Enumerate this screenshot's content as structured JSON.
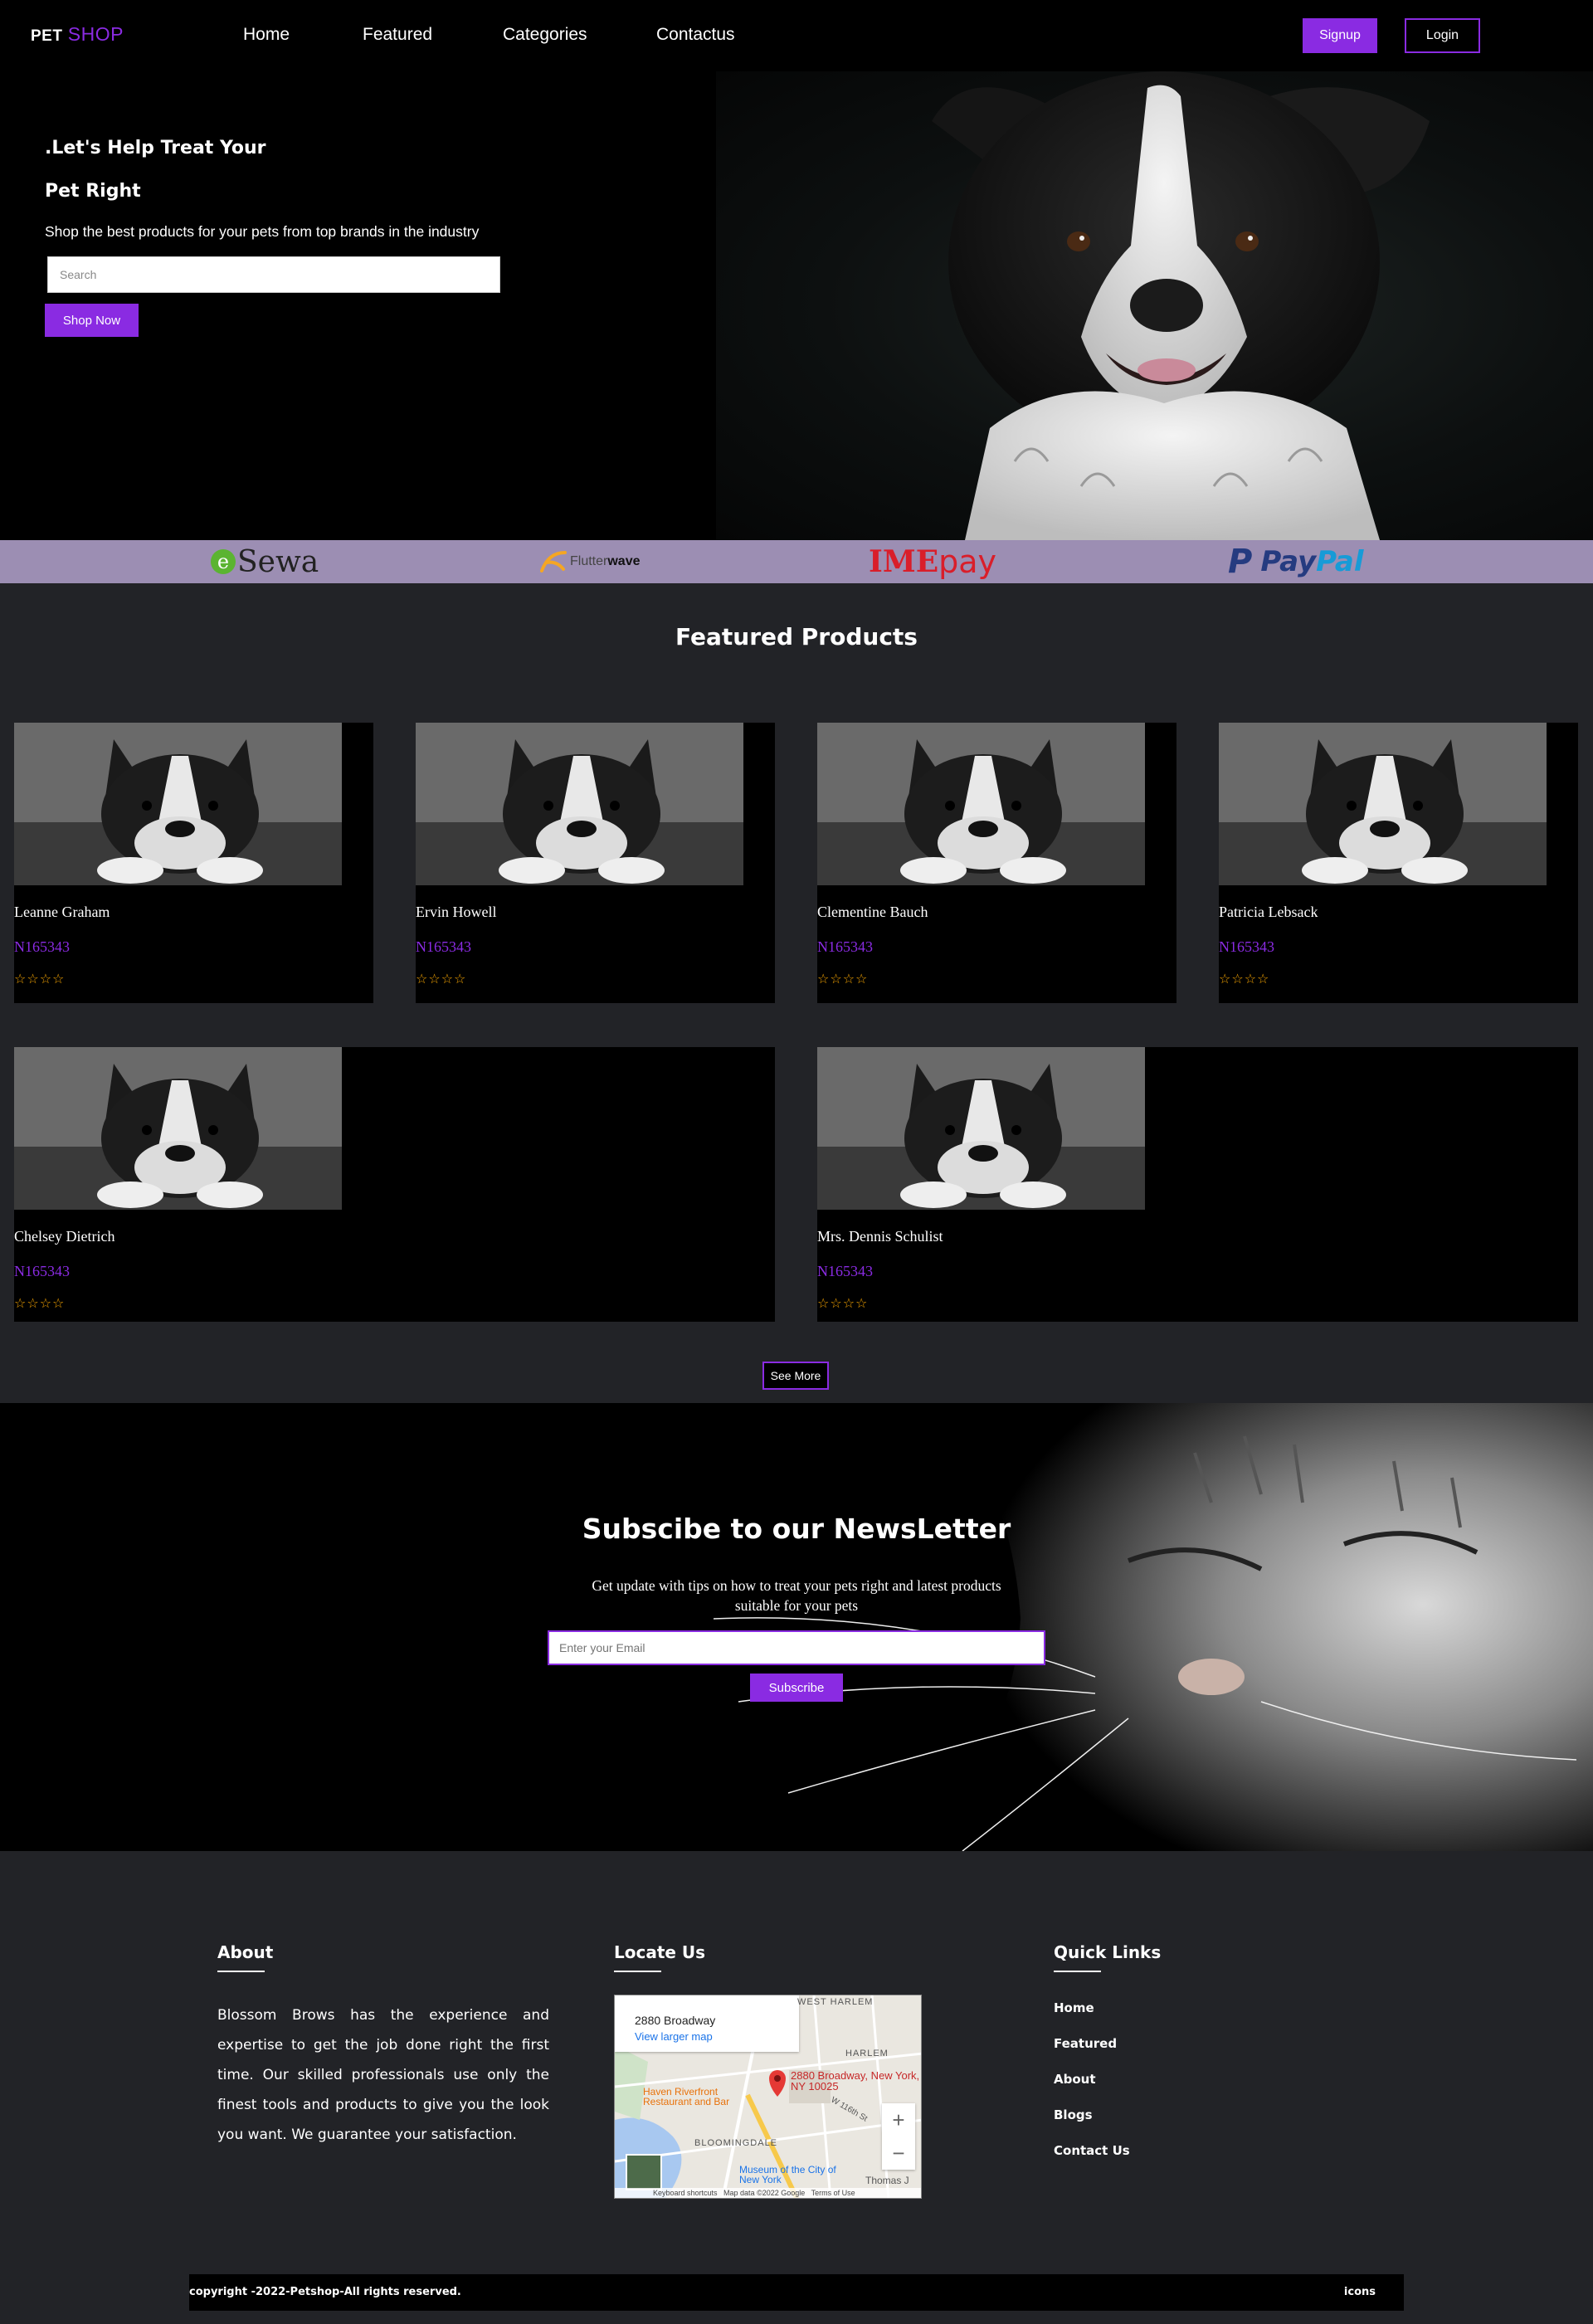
{
  "nav": {
    "logo_pet": "PET",
    "logo_shop": "SHOP",
    "links": [
      "Home",
      "Featured",
      "Categories",
      "Contactus"
    ],
    "signup": "Signup",
    "login": "Login"
  },
  "hero": {
    "title_line1": ".Let's Help Treat Your",
    "title_line2": "Pet Right",
    "subtitle": "Shop the best products for your pets from top brands in the industry",
    "search_placeholder": "Search",
    "shop_now": "Shop Now"
  },
  "payments": {
    "esewa_e": "e",
    "esewa": "Sewa",
    "flutterwave_a": "Flutter",
    "flutterwave_b": "wave",
    "imepay_a": "IME",
    "imepay_b": "pay",
    "paypal_a": "Pay",
    "paypal_b": "Pal"
  },
  "featured": {
    "title": "Featured Products",
    "products": [
      {
        "name": "Leanne Graham",
        "code": "N165343",
        "stars": "☆☆☆☆"
      },
      {
        "name": "Ervin Howell",
        "code": "N165343",
        "stars": "☆☆☆☆"
      },
      {
        "name": "Clementine Bauch",
        "code": "N165343",
        "stars": "☆☆☆☆"
      },
      {
        "name": "Patricia Lebsack",
        "code": "N165343",
        "stars": "☆☆☆☆"
      },
      {
        "name": "Chelsey Dietrich",
        "code": "N165343",
        "stars": "☆☆☆☆"
      },
      {
        "name": "Mrs. Dennis Schulist",
        "code": "N165343",
        "stars": "☆☆☆☆"
      }
    ],
    "see_more": "See More"
  },
  "newsletter": {
    "title": "Subscibe to our NewsLetter",
    "text": "Get update with tips on how to treat your pets right and latest products suitable for your pets",
    "email_placeholder": "Enter your Email",
    "subscribe": "Subscribe"
  },
  "footer": {
    "about_title": "About",
    "about_text": "Blossom Brows has the experience and expertise to get the job done right the first time. Our skilled professionals use only the finest tools and products to give you the look you want. We guarantee your satisfaction.",
    "locate_title": "Locate Us",
    "map": {
      "place": "2880 Broadway",
      "larger_map": "View larger map",
      "pin_label": "2880 Broadway, New York, NY 10025",
      "area_1": "WEST HARLEM",
      "area_2": "HARLEM",
      "area_3": "BLOOMINGDALE",
      "restaurant": "Haven Riverfront Restaurant and Bar",
      "museum": "Museum of the City of New York",
      "thomas": "Thomas J",
      "street": "W 116th St",
      "attribution": "Keyboard shortcuts   Map data ©2022 Google   Terms of Use"
    },
    "quick_title": "Quick Links",
    "quick_links": [
      "Home",
      "Featured",
      "About",
      "Blogs",
      "Contact Us"
    ],
    "copyright": "copyright -2022-Petshop-All rights reserved.",
    "icons": "icons"
  },
  "colors": {
    "accent": "#8a2be2",
    "payments_bg": "#9c8eb3",
    "section_bg": "#222327",
    "star": "#f4a300"
  }
}
